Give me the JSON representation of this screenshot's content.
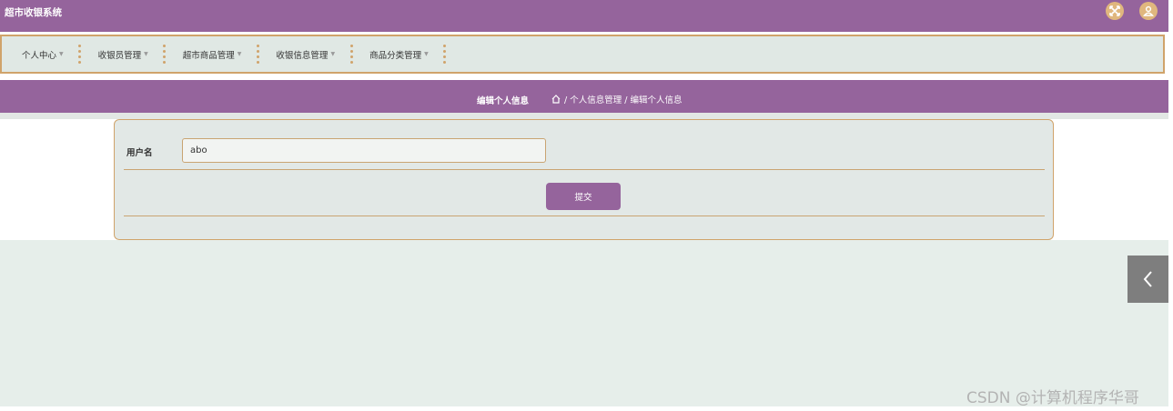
{
  "header": {
    "title": "超市收银系统",
    "icons": [
      "fullscreen-icon",
      "user-icon"
    ],
    "accent_color": "#95649c",
    "icon_color": "#e0b77e"
  },
  "nav": {
    "items": [
      {
        "label": "个人中心"
      },
      {
        "label": "收银员管理"
      },
      {
        "label": "超市商品管理"
      },
      {
        "label": "收银信息管理"
      },
      {
        "label": "商品分类管理"
      }
    ]
  },
  "breadcrumb": {
    "page_title": "编辑个人信息",
    "path": "/ 个人信息管理 / 编辑个人信息"
  },
  "form": {
    "username_label": "用户名",
    "username_value": "abo",
    "submit_label": "提交"
  },
  "watermark": "CSDN @计算机程序华哥"
}
